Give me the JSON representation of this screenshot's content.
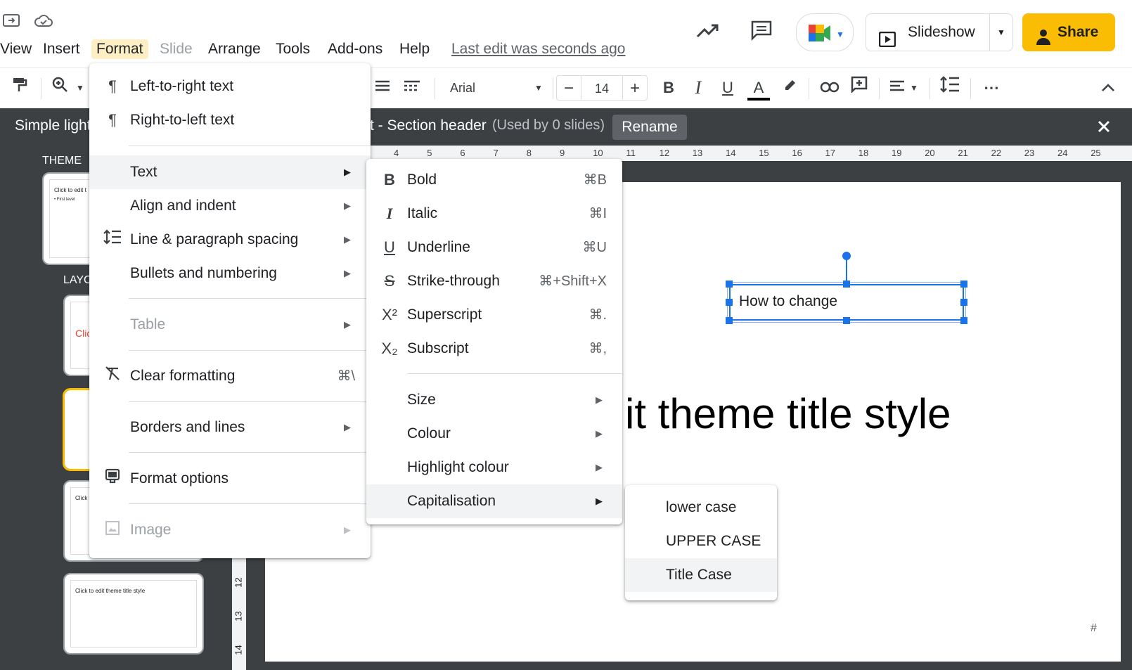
{
  "menubar": {
    "items": [
      "View",
      "Insert",
      "Format",
      "Slide",
      "Arrange",
      "Tools",
      "Add-ons",
      "Help"
    ],
    "last_edit": "Last edit was seconds ago"
  },
  "header": {
    "slideshow_label": "Slideshow",
    "share_label": "Share"
  },
  "toolbar": {
    "font_name": "Arial",
    "font_size": "14"
  },
  "editorbar": {
    "theme_name": "Simple light",
    "layout_name": "t - Section header",
    "used_by": "(Used by 0 slides)",
    "rename_label": "Rename"
  },
  "leftpanel": {
    "theme_label": "THEME",
    "layouts_label": "LAYO",
    "thumb1_text": "Click to edit t",
    "thumb2_text": "Clic",
    "thumb4_text": "Click t",
    "thumb5_text": "Click to edit theme title style",
    "bullet_text": "First level"
  },
  "ruler": {
    "ticks": [
      "4",
      "5",
      "6",
      "7",
      "8",
      "9",
      "10",
      "11",
      "12",
      "13",
      "14",
      "15",
      "16",
      "17",
      "18",
      "19",
      "20",
      "21",
      "22",
      "23",
      "24",
      "25"
    ],
    "vticks": [
      "12",
      "13",
      "14"
    ]
  },
  "slide": {
    "textbox_text": "How to change",
    "title_text": "it theme title style",
    "page_number": "#"
  },
  "format_menu": {
    "items": [
      {
        "label": "Left-to-right text",
        "icon": "ltr-text-icon"
      },
      {
        "label": "Right-to-left text",
        "icon": "rtl-text-icon"
      },
      {
        "label": "Text",
        "submenu": true
      },
      {
        "label": "Align and indent",
        "submenu": true
      },
      {
        "label": "Line & paragraph spacing",
        "submenu": true,
        "icon": "line-spacing-icon"
      },
      {
        "label": "Bullets and numbering",
        "submenu": true
      },
      {
        "label": "Table",
        "submenu": true,
        "disabled": true
      },
      {
        "label": "Clear formatting",
        "shortcut": "⌘\\",
        "icon": "clear-formatting-icon"
      },
      {
        "label": "Borders and lines",
        "submenu": true
      },
      {
        "label": "Format options",
        "icon": "format-options-icon"
      },
      {
        "label": "Image",
        "submenu": true,
        "disabled": true,
        "icon": "image-icon"
      }
    ]
  },
  "text_submenu": {
    "items": [
      {
        "label": "Bold",
        "shortcut": "⌘B",
        "icon": "bold-icon"
      },
      {
        "label": "Italic",
        "shortcut": "⌘I",
        "icon": "italic-icon"
      },
      {
        "label": "Underline",
        "shortcut": "⌘U",
        "icon": "underline-icon"
      },
      {
        "label": "Strike-through",
        "shortcut": "⌘+Shift+X",
        "icon": "strikethrough-icon"
      },
      {
        "label": "Superscript",
        "shortcut": "⌘.",
        "icon": "superscript-icon"
      },
      {
        "label": "Subscript",
        "shortcut": "⌘,",
        "icon": "subscript-icon"
      },
      {
        "label": "Size",
        "submenu": true
      },
      {
        "label": "Colour",
        "submenu": true
      },
      {
        "label": "Highlight colour",
        "submenu": true
      },
      {
        "label": "Capitalisation",
        "submenu": true
      }
    ]
  },
  "caps_submenu": {
    "items": [
      "lower case",
      "UPPER CASE",
      "Title Case"
    ]
  },
  "colors": {
    "accent": "#1a73e8",
    "share": "#fbbc04",
    "dark": "#3c4043"
  }
}
